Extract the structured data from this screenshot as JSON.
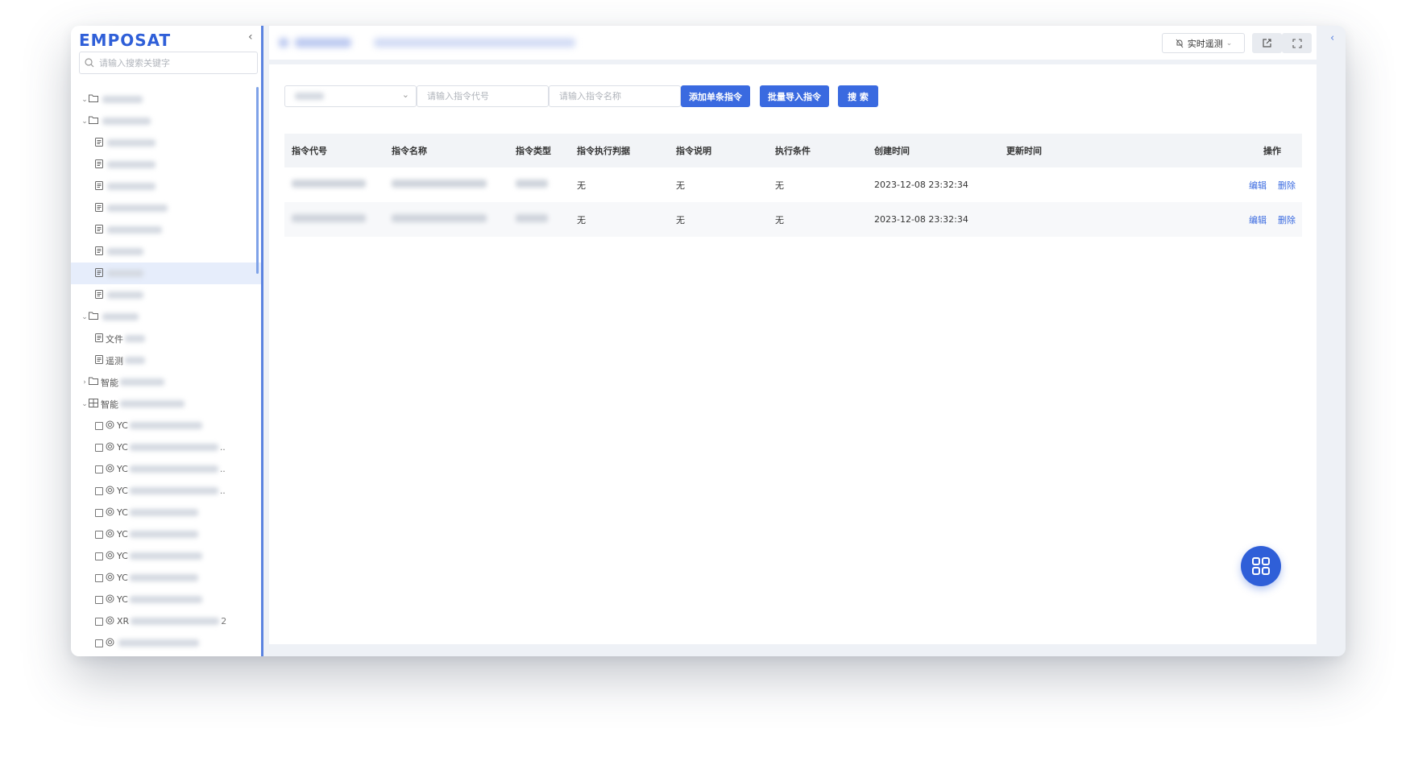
{
  "app": {
    "logo": "EMPOSAT"
  },
  "sidebar": {
    "search_placeholder": "请输入搜索关键字",
    "tree": [
      {
        "indent": 0,
        "caret": "down",
        "icon": "folder",
        "label": "",
        "blur": 50
      },
      {
        "indent": 0,
        "caret": "down",
        "icon": "folder",
        "label": "",
        "blur": 60
      },
      {
        "indent": 1,
        "caret": "",
        "icon": "doc",
        "label": "",
        "blur": 60
      },
      {
        "indent": 1,
        "caret": "",
        "icon": "doc",
        "label": "",
        "blur": 60
      },
      {
        "indent": 1,
        "caret": "",
        "icon": "doc",
        "label": "",
        "blur": 60
      },
      {
        "indent": 1,
        "caret": "",
        "icon": "doc",
        "label": "",
        "blur": 75
      },
      {
        "indent": 1,
        "caret": "",
        "icon": "doc",
        "label": "",
        "blur": 68
      },
      {
        "indent": 1,
        "caret": "",
        "icon": "doc",
        "label": "",
        "blur": 45
      },
      {
        "indent": 1,
        "caret": "",
        "icon": "doc",
        "label": "",
        "blur": 45,
        "selected": true
      },
      {
        "indent": 1,
        "caret": "",
        "icon": "doc",
        "label": "",
        "blur": 45
      },
      {
        "indent": 0,
        "caret": "down",
        "icon": "folder",
        "label": "",
        "blur": 45
      },
      {
        "indent": 1,
        "caret": "",
        "icon": "doc",
        "label": "文件",
        "blur": 25
      },
      {
        "indent": 1,
        "caret": "",
        "icon": "doc",
        "label": "遥测",
        "blur": 25
      },
      {
        "indent": 0,
        "caret": "right",
        "icon": "folder",
        "label": "智能",
        "blur": 55
      },
      {
        "indent": 0,
        "caret": "down",
        "icon": "grid",
        "label": "智能",
        "blur": 80
      },
      {
        "indent": 1,
        "caret": "",
        "icon": "sat",
        "label": "YC",
        "blur": 90,
        "checkbox": true
      },
      {
        "indent": 1,
        "caret": "",
        "icon": "sat",
        "label": "YC",
        "blur": 110,
        "checkbox": true,
        "dots": ".."
      },
      {
        "indent": 1,
        "caret": "",
        "icon": "sat",
        "label": "YC",
        "blur": 110,
        "checkbox": true,
        "dots": ".."
      },
      {
        "indent": 1,
        "caret": "",
        "icon": "sat",
        "label": "YC",
        "blur": 110,
        "checkbox": true,
        "dots": ".."
      },
      {
        "indent": 1,
        "caret": "",
        "icon": "sat",
        "label": "YC",
        "blur": 85,
        "checkbox": true
      },
      {
        "indent": 1,
        "caret": "",
        "icon": "sat",
        "label": "YC",
        "blur": 85,
        "checkbox": true
      },
      {
        "indent": 1,
        "caret": "",
        "icon": "sat",
        "label": "YC",
        "blur": 90,
        "checkbox": true
      },
      {
        "indent": 1,
        "caret": "",
        "icon": "sat",
        "label": "YC",
        "blur": 85,
        "checkbox": true
      },
      {
        "indent": 1,
        "caret": "",
        "icon": "sat",
        "label": "YC",
        "blur": 90,
        "checkbox": true
      },
      {
        "indent": 1,
        "caret": "",
        "icon": "sat",
        "label": "XR",
        "blur": 110,
        "checkbox": true,
        "dots": "2"
      },
      {
        "indent": 1,
        "caret": "",
        "icon": "sat",
        "label": "",
        "blur": 100,
        "checkbox": true
      }
    ]
  },
  "header": {
    "realtime_label": "实时遥测"
  },
  "toolbar": {
    "code_placeholder": "请输入指令代号",
    "name_placeholder": "请输入指令名称",
    "add_single_label": "添加单条指令",
    "batch_import_label": "批量导入指令",
    "search_label": "搜 索"
  },
  "table": {
    "columns": [
      "指令代号",
      "指令名称",
      "指令类型",
      "指令执行判据",
      "指令说明",
      "执行条件",
      "创建时间",
      "更新时间",
      "操作"
    ],
    "rows": [
      {
        "criteria": "无",
        "description": "无",
        "condition": "无",
        "created": "2023-12-08 23:32:34",
        "updated": "",
        "edit": "编辑",
        "delete": "删除"
      },
      {
        "criteria": "无",
        "description": "无",
        "condition": "无",
        "created": "2023-12-08 23:32:34",
        "updated": "",
        "edit": "编辑",
        "delete": "删除"
      }
    ]
  },
  "colors": {
    "primary": "#3a6ae0",
    "logo": "#2f5fd8",
    "selected_bg": "#e6edfb"
  }
}
